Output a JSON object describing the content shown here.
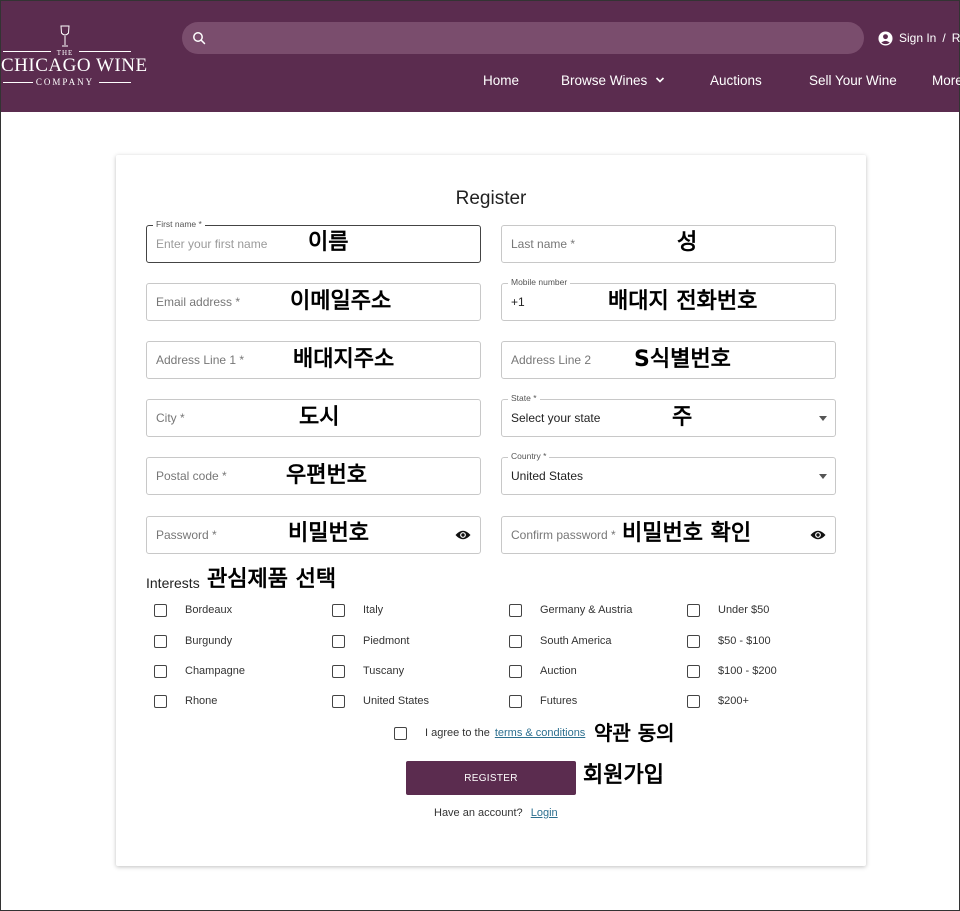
{
  "header": {
    "logo": {
      "the": "THE",
      "name": "CHICAGO WINE",
      "company": "COMPANY"
    },
    "search_placeholder": "",
    "sign_in": "Sign In",
    "sign_sep": "/",
    "register_cut": "Re",
    "nav": [
      "Home",
      "Browse Wines",
      "Auctions",
      "Sell Your Wine",
      "More"
    ]
  },
  "colors": {
    "brand": "#5b2c4f",
    "link": "#2c6f8f"
  },
  "form": {
    "title": "Register",
    "first_name": {
      "label": "First name *",
      "placeholder": "Enter your first name",
      "annotation": "이름"
    },
    "last_name": {
      "placeholder": "Last name *",
      "annotation": "성"
    },
    "email": {
      "placeholder": "Email address *",
      "annotation": "이메일주소"
    },
    "mobile": {
      "label": "Mobile number",
      "value": "+1",
      "annotation": "배대지 전화번호"
    },
    "address1": {
      "placeholder": "Address Line 1 *",
      "annotation": "배대지주소"
    },
    "address2": {
      "placeholder": "Address Line 2",
      "annotation": "S식별번호"
    },
    "city": {
      "placeholder": "City *",
      "annotation": "도시"
    },
    "state": {
      "label": "State *",
      "value": "Select your state",
      "annotation": "주"
    },
    "postal": {
      "placeholder": "Postal code *",
      "annotation": "우편번호"
    },
    "country": {
      "label": "Country *",
      "value": "United States"
    },
    "password": {
      "placeholder": "Password *",
      "annotation": "비밀번호"
    },
    "confirm_password": {
      "placeholder": "Confirm password *",
      "annotation": "비밀번호 확인"
    },
    "interests_label": "Interests",
    "interests_annotation": "관심제품 선택",
    "interests": [
      [
        "Bordeaux",
        "Burgundy",
        "Champagne",
        "Rhone"
      ],
      [
        "Italy",
        "Piedmont",
        "Tuscany",
        "United States"
      ],
      [
        "Germany & Austria",
        "South America",
        "Auction",
        "Futures"
      ],
      [
        "Under $50",
        "$50 - $100",
        "$100 - $200",
        "$200+"
      ]
    ],
    "agree_text": "I agree to the",
    "terms_link": "terms & conditions",
    "agree_annotation": "약관 동의",
    "register_button": "REGISTER",
    "register_annotation": "회원가입",
    "have_account": "Have an account?",
    "login_link": "Login"
  }
}
